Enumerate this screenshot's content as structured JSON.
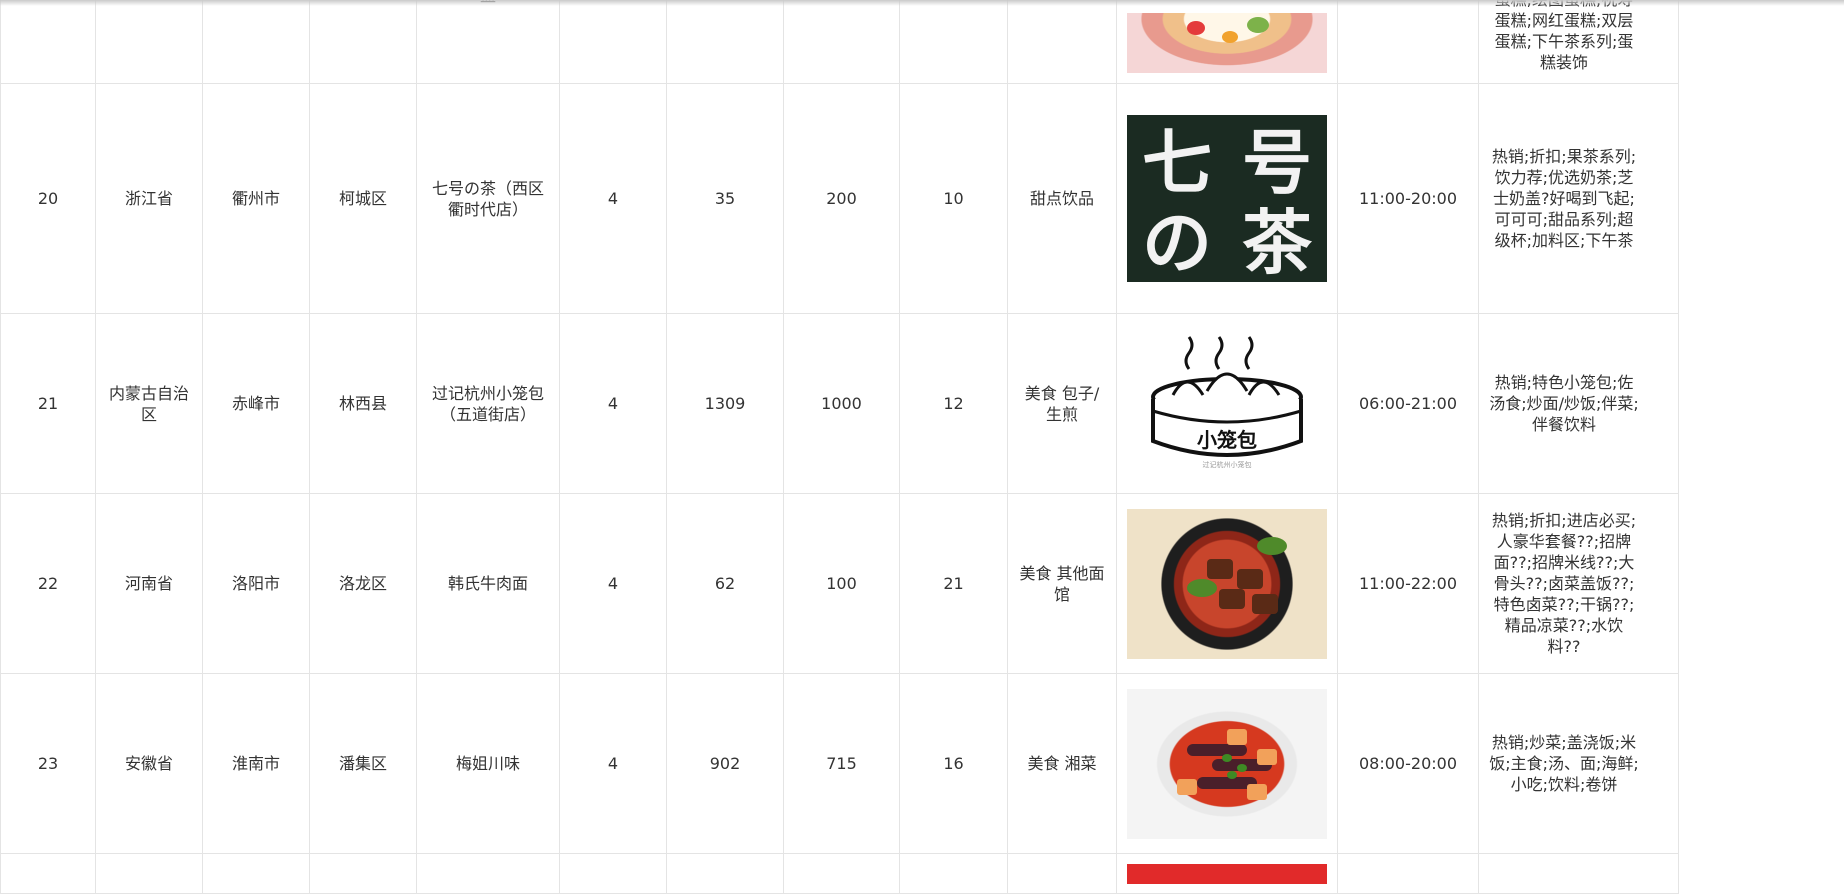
{
  "rows_partial_top": {
    "tags": "蛋糕;绘图蛋糕;祝寿蛋糕;网红蛋糕;双层蛋糕;下午茶系列;蛋糕装饰",
    "image_icon": "cake-photo",
    "cut_text": "蛊"
  },
  "rows": [
    {
      "id": "20",
      "province": "浙江省",
      "city": "衢州市",
      "district": "柯城区",
      "shop_name": "七号の茶（西区衢时代店）",
      "rating": "4",
      "monthly_sales": "35",
      "min_order": "200",
      "delivery_fee": "10",
      "category": "甜点饮品",
      "image_icon": "tea-shop-logo",
      "logo_text": [
        "七",
        "号",
        "の",
        "茶"
      ],
      "hours": "11:00-20:00",
      "tags": "热销;折扣;果茶系列;饮力荐;优选奶茶;芝士奶盖?好喝到飞起;可可可;甜品系列;超级杯;加料区;下午茶"
    },
    {
      "id": "21",
      "province": "内蒙古自治区",
      "city": "赤峰市",
      "district": "林西县",
      "shop_name": "过记杭州小笼包（五道街店）",
      "rating": "4",
      "monthly_sales": "1309",
      "min_order": "1000",
      "delivery_fee": "12",
      "category": "美食 包子/生煎",
      "image_icon": "xiaolongbao-logo",
      "logo_text": "小笼包",
      "logo_subtext": "过记杭州小笼包",
      "hours": "06:00-21:00",
      "tags": "热销;特色小笼包;佐汤食;炒面/炒饭;伴菜;伴餐饮料"
    },
    {
      "id": "22",
      "province": "河南省",
      "city": "洛阳市",
      "district": "洛龙区",
      "shop_name": "韩氏牛肉面",
      "rating": "4",
      "monthly_sales": "62",
      "min_order": "100",
      "delivery_fee": "21",
      "category": "美食 其他面馆",
      "image_icon": "beef-noodle-photo",
      "hours": "11:00-22:00",
      "tags": "热销;折扣;进店必买;人豪华套餐??;招牌面??;招牌米线??;大骨头??;卤菜盖饭??;特色卤菜??;干锅??;精品凉菜??;水饮料??"
    },
    {
      "id": "23",
      "province": "安徽省",
      "city": "淮南市",
      "district": "潘集区",
      "shop_name": "梅姐川味",
      "rating": "4",
      "monthly_sales": "902",
      "min_order": "715",
      "delivery_fee": "16",
      "category": "美食 湘菜",
      "image_icon": "eggplant-dish-photo",
      "hours": "08:00-20:00",
      "tags": "热销;炒菜;盖浇饭;米饭;主食;汤、面;海鲜;小吃;饮料;卷饼"
    }
  ],
  "rows_partial_bottom": {
    "image_icon": "red-banner-photo"
  }
}
